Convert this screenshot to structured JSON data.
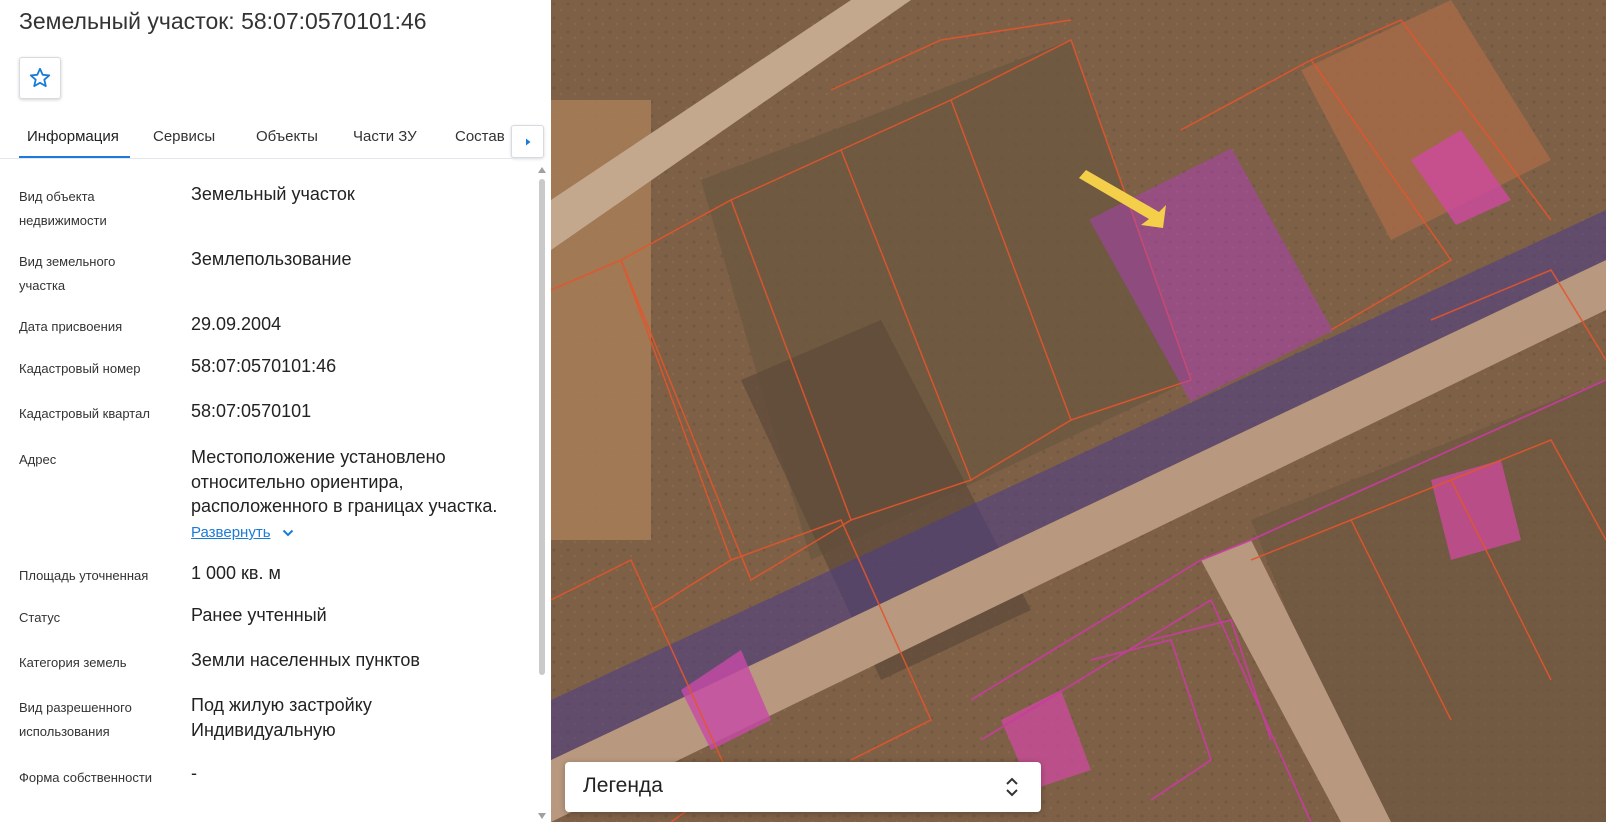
{
  "header": {
    "title": "Земельный участок: 58:07:0570101:46",
    "favorite_icon": "star-outline-icon"
  },
  "tabs": [
    {
      "label": "Информация",
      "active": true
    },
    {
      "label": "Сервисы",
      "active": false
    },
    {
      "label": "Объекты",
      "active": false
    },
    {
      "label": "Части ЗУ",
      "active": false
    },
    {
      "label": "Состав",
      "active": false
    }
  ],
  "properties": [
    {
      "label": "Вид объекта недвижимости",
      "value": "Земельный участок"
    },
    {
      "label": "Вид земельного участка",
      "value": "Землепользование"
    },
    {
      "label": "Дата присвоения",
      "value": "29.09.2004"
    },
    {
      "label": "Кадастровый номер",
      "value": "58:07:0570101:46"
    },
    {
      "label": "Кадастровый квартал",
      "value": "58:07:0570101"
    },
    {
      "label": "Адрес",
      "value": "Местоположение установлено относительно ориентира, расположенного в границах участка.",
      "expand_label": "Развернуть"
    },
    {
      "label": "Площадь уточненная",
      "value": "1 000 кв. м"
    },
    {
      "label": "Статус",
      "value": "Ранее учтенный"
    },
    {
      "label": "Категория земель",
      "value": "Земли населенных пунктов"
    },
    {
      "label": "Вид разрешенного использования",
      "value": "Под жилую застройку Индивидуальную"
    },
    {
      "label": "Форма собственности",
      "value": "-"
    }
  ],
  "legend": {
    "label": "Легенда",
    "toggle_icon": "chevron-up-down-icon"
  },
  "colors": {
    "accent": "#1c7bd6",
    "parcel_outline": "#e4552c",
    "selected_parcel": "#b43cc8",
    "zone_fill": "#5a46c8",
    "marker_arrow": "#f4cf4a"
  }
}
